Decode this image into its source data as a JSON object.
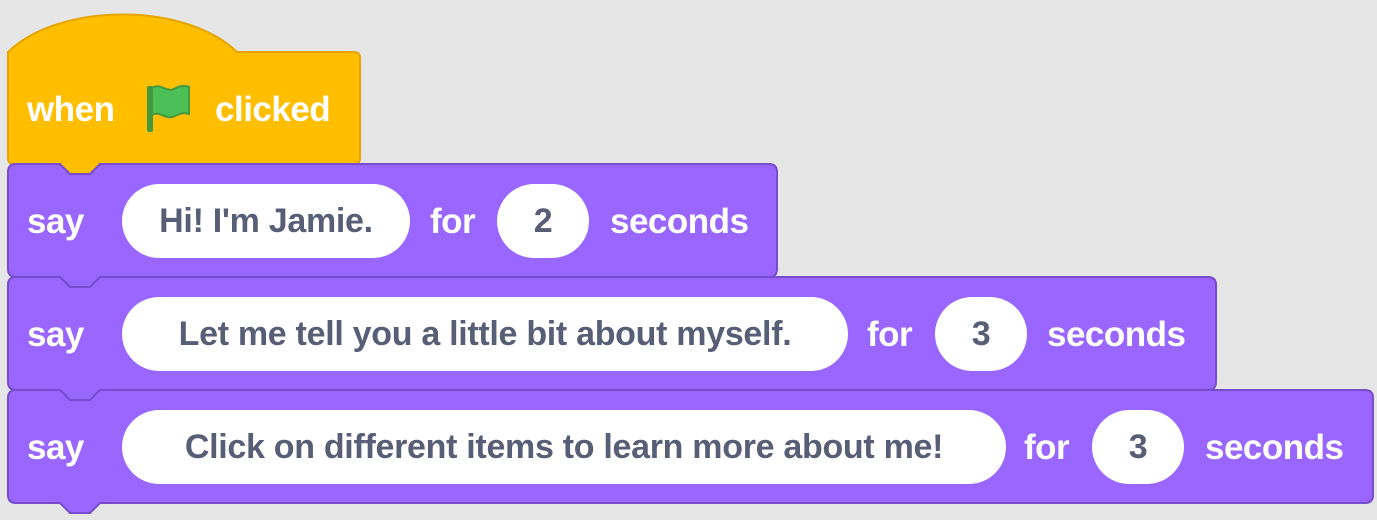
{
  "colors": {
    "event_block": "#ffbf00",
    "event_block_shadow": "#e6a400",
    "looks_block": "#9966ff",
    "looks_block_shadow": "#774dcb",
    "input_fill": "#ffffff",
    "input_text": "#575e75",
    "flag_green": "#4cbf56",
    "flag_dark": "#45993d",
    "background": "#e6e6e6"
  },
  "hat_block": {
    "when_label": "when",
    "flag_icon": "green-flag-icon",
    "clicked_label": "clicked"
  },
  "say_blocks": [
    {
      "say_label": "say",
      "message": "Hi! I'm Jamie.",
      "for_label": "for",
      "duration": "2",
      "seconds_label": "seconds"
    },
    {
      "say_label": "say",
      "message": "Let me tell you a little bit about myself.",
      "for_label": "for",
      "duration": "3",
      "seconds_label": "seconds"
    },
    {
      "say_label": "say",
      "message": "Click on different items to learn more about me!",
      "for_label": "for",
      "duration": "3",
      "seconds_label": "seconds"
    }
  ]
}
